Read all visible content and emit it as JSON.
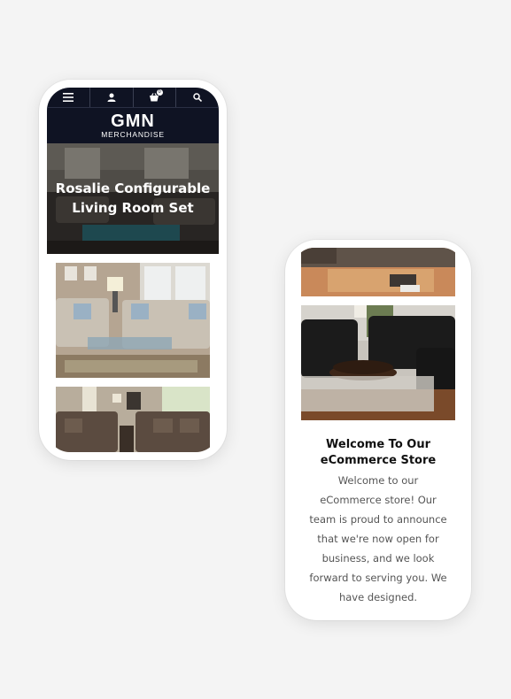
{
  "header": {
    "icons": [
      "menu-icon",
      "user-icon",
      "cart-icon",
      "search-icon"
    ],
    "cart_count": "0"
  },
  "logo": {
    "title": "GMN",
    "subtitle": "MERCHANDISE"
  },
  "hero": {
    "title_line1": "Rosalie Configurable",
    "title_line2": "Living Room Set"
  },
  "welcome": {
    "title_line1": "Welcome To Our",
    "title_line2": "eCommerce Store",
    "body_lines": [
      "Welcome to our",
      "eCommerce store! Our",
      "team is proud to announce",
      "that we're now open for",
      "business, and we look",
      "forward to serving you. We",
      "have designed."
    ]
  },
  "colors": {
    "header_bg": "#0f1323",
    "page_bg": "#f4f4f4",
    "text_body": "#555555"
  }
}
